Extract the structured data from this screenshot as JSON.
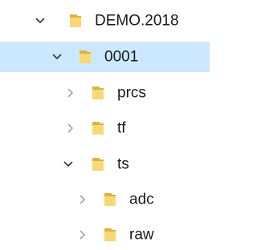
{
  "tree": {
    "nodes": [
      {
        "label": "DEMO.2018",
        "expanded": true,
        "selected": false,
        "icon": "folder-icon",
        "chevron": "chevron-down-icon"
      },
      {
        "label": "0001",
        "expanded": true,
        "selected": true,
        "icon": "folder-icon",
        "chevron": "chevron-down-icon"
      },
      {
        "label": "prcs",
        "expanded": false,
        "selected": false,
        "icon": "folder-icon",
        "chevron": "chevron-right-icon"
      },
      {
        "label": "tf",
        "expanded": false,
        "selected": false,
        "icon": "folder-icon",
        "chevron": "chevron-right-icon"
      },
      {
        "label": "ts",
        "expanded": true,
        "selected": false,
        "icon": "folder-icon",
        "chevron": "chevron-down-icon"
      },
      {
        "label": "adc",
        "expanded": false,
        "selected": false,
        "icon": "folder-icon",
        "chevron": "chevron-right-icon"
      },
      {
        "label": "raw",
        "expanded": false,
        "selected": false,
        "icon": "folder-icon",
        "chevron": "chevron-right-icon"
      }
    ]
  },
  "colors": {
    "selection": "#cce8ff",
    "folder_front": "#f8d775",
    "folder_back": "#dcb13f",
    "chevron_expanded": "#333333",
    "chevron_collapsed": "#a6a6a6"
  }
}
